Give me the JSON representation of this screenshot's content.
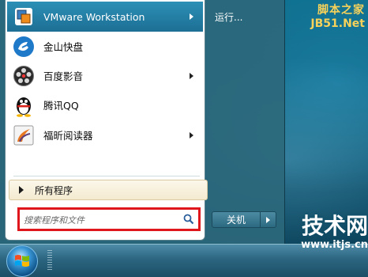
{
  "start_menu": {
    "pinned": [
      {
        "label": "VMware Workstation",
        "icon": "vmware-icon",
        "has_submenu": true
      },
      {
        "label": "金山快盘",
        "icon": "kuaipan-icon",
        "has_submenu": false
      },
      {
        "label": "百度影音",
        "icon": "baidu-player-icon",
        "has_submenu": true
      },
      {
        "label": "腾讯QQ",
        "icon": "qq-penguin-icon",
        "has_submenu": false
      },
      {
        "label": "福昕阅读器",
        "icon": "foxit-reader-icon",
        "has_submenu": true
      }
    ],
    "all_programs_label": "所有程序",
    "search": {
      "placeholder": "搜索程序和文件"
    },
    "right_pane": {
      "run_label": "运行..."
    },
    "shutdown_label": "关机"
  },
  "watermarks": {
    "top_line1": "脚本之家",
    "top_line2": "JB51.Net",
    "bottom_line1": "技术网",
    "bottom_line2": "www.itjs.cn"
  },
  "colors": {
    "highlight": "#1d6f95",
    "search_highlight_border": "#e0161d",
    "watermark_gold": "#f7d25a"
  }
}
